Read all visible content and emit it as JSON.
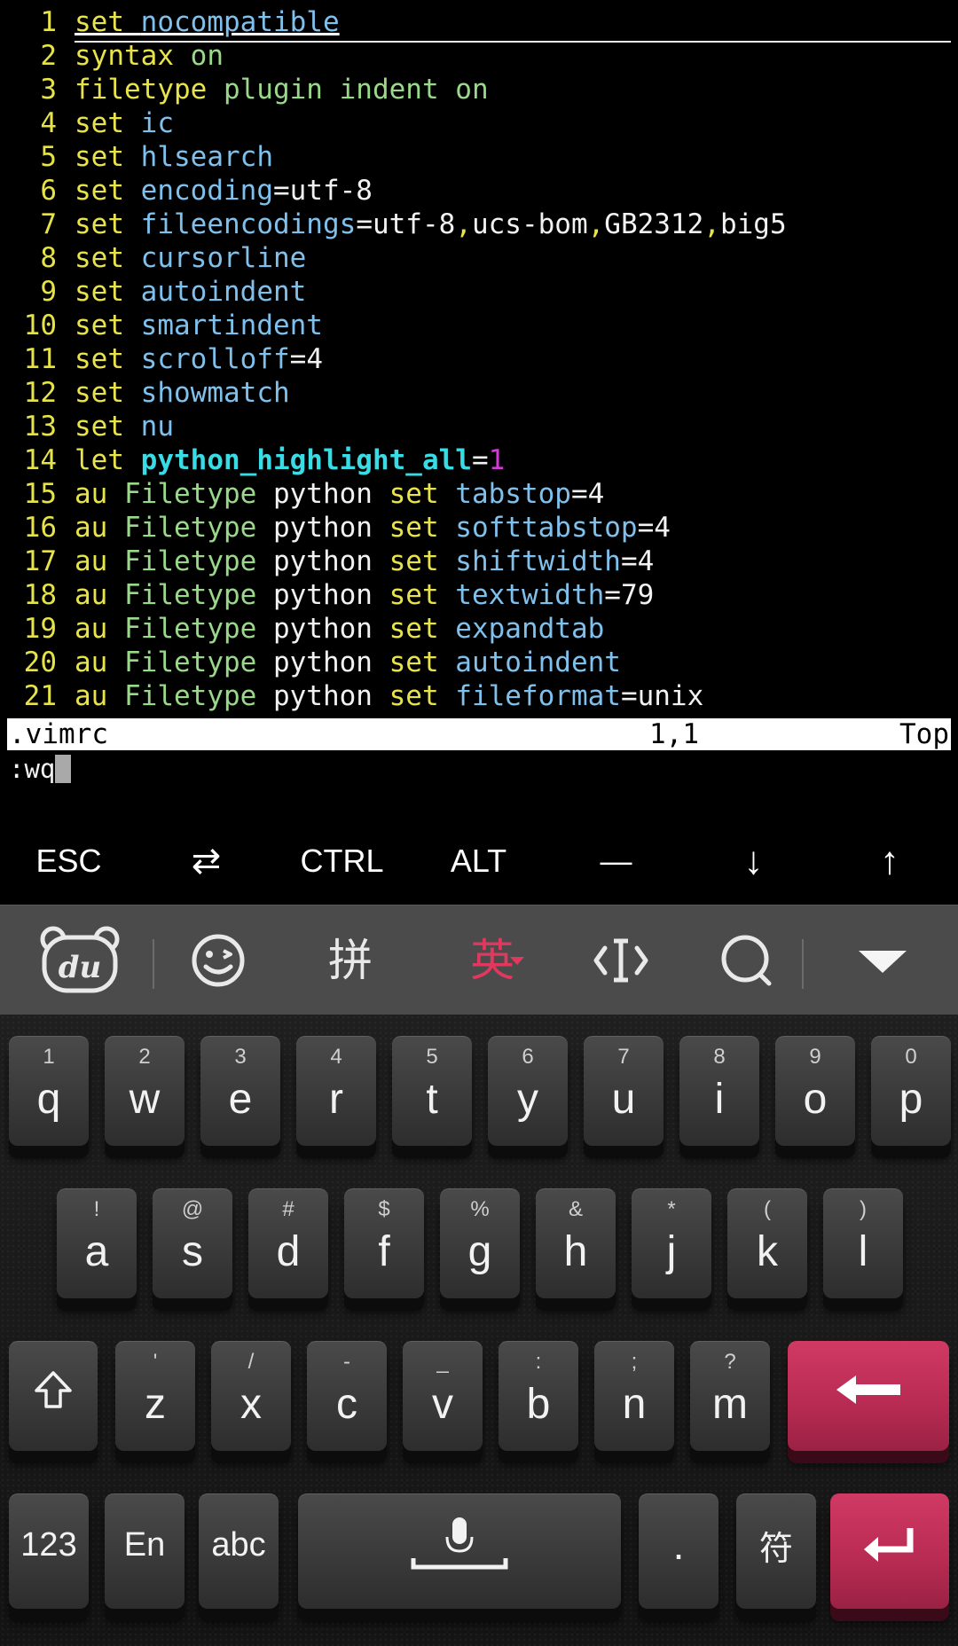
{
  "editor": {
    "lines": [
      {
        "num": "1",
        "tokens": [
          {
            "t": "set",
            "c": "kw"
          },
          {
            "t": " "
          },
          {
            "t": "nocompatible",
            "c": "opt"
          }
        ]
      },
      {
        "num": "2",
        "tokens": [
          {
            "t": "syntax",
            "c": "kw"
          },
          {
            "t": " "
          },
          {
            "t": "on",
            "c": "green"
          }
        ]
      },
      {
        "num": "3",
        "tokens": [
          {
            "t": "filetype",
            "c": "kw"
          },
          {
            "t": " "
          },
          {
            "t": "plugin",
            "c": "green"
          },
          {
            "t": " "
          },
          {
            "t": "indent",
            "c": "green"
          },
          {
            "t": " "
          },
          {
            "t": "on",
            "c": "green"
          }
        ]
      },
      {
        "num": "4",
        "tokens": [
          {
            "t": "set",
            "c": "kw"
          },
          {
            "t": " "
          },
          {
            "t": "ic",
            "c": "opt"
          }
        ]
      },
      {
        "num": "5",
        "tokens": [
          {
            "t": "set",
            "c": "kw"
          },
          {
            "t": " "
          },
          {
            "t": "hlsearch",
            "c": "opt"
          }
        ]
      },
      {
        "num": "6",
        "tokens": [
          {
            "t": "set",
            "c": "kw"
          },
          {
            "t": " "
          },
          {
            "t": "encoding",
            "c": "opt"
          },
          {
            "t": "=utf-8",
            "c": "plain"
          }
        ]
      },
      {
        "num": "7",
        "tokens": [
          {
            "t": "set",
            "c": "kw"
          },
          {
            "t": " "
          },
          {
            "t": "fileencodings",
            "c": "opt"
          },
          {
            "t": "=utf-8",
            "c": "plain"
          },
          {
            "t": ",",
            "c": "kw"
          },
          {
            "t": "ucs-bom",
            "c": "plain"
          },
          {
            "t": ",",
            "c": "kw"
          },
          {
            "t": "GB2312",
            "c": "plain"
          },
          {
            "t": ",",
            "c": "kw"
          },
          {
            "t": "big5",
            "c": "plain"
          }
        ]
      },
      {
        "num": "8",
        "tokens": [
          {
            "t": "set",
            "c": "kw"
          },
          {
            "t": " "
          },
          {
            "t": "cursorline",
            "c": "opt"
          }
        ]
      },
      {
        "num": "9",
        "tokens": [
          {
            "t": "set",
            "c": "kw"
          },
          {
            "t": " "
          },
          {
            "t": "autoindent",
            "c": "opt"
          }
        ]
      },
      {
        "num": "10",
        "tokens": [
          {
            "t": "set",
            "c": "kw"
          },
          {
            "t": " "
          },
          {
            "t": "smartindent",
            "c": "opt"
          }
        ]
      },
      {
        "num": "11",
        "tokens": [
          {
            "t": "set",
            "c": "kw"
          },
          {
            "t": " "
          },
          {
            "t": "scrolloff",
            "c": "opt"
          },
          {
            "t": "=4",
            "c": "plain"
          }
        ]
      },
      {
        "num": "12",
        "tokens": [
          {
            "t": "set",
            "c": "kw"
          },
          {
            "t": " "
          },
          {
            "t": "showmatch",
            "c": "opt"
          }
        ]
      },
      {
        "num": "13",
        "tokens": [
          {
            "t": "set",
            "c": "kw"
          },
          {
            "t": " "
          },
          {
            "t": "nu",
            "c": "opt"
          }
        ]
      },
      {
        "num": "14",
        "tokens": [
          {
            "t": "let",
            "c": "kw"
          },
          {
            "t": " "
          },
          {
            "t": "python_highlight_all",
            "c": "cyanbold"
          },
          {
            "t": "=",
            "c": "plain"
          },
          {
            "t": "1",
            "c": "magenta"
          }
        ]
      },
      {
        "num": "15",
        "tokens": [
          {
            "t": "au",
            "c": "kw"
          },
          {
            "t": " "
          },
          {
            "t": "Filetype",
            "c": "green"
          },
          {
            "t": " python ",
            "c": "plain"
          },
          {
            "t": "set",
            "c": "kw"
          },
          {
            "t": " "
          },
          {
            "t": "tabstop",
            "c": "opt"
          },
          {
            "t": "=4",
            "c": "plain"
          }
        ]
      },
      {
        "num": "16",
        "tokens": [
          {
            "t": "au",
            "c": "kw"
          },
          {
            "t": " "
          },
          {
            "t": "Filetype",
            "c": "green"
          },
          {
            "t": " python ",
            "c": "plain"
          },
          {
            "t": "set",
            "c": "kw"
          },
          {
            "t": " "
          },
          {
            "t": "softtabstop",
            "c": "opt"
          },
          {
            "t": "=4",
            "c": "plain"
          }
        ]
      },
      {
        "num": "17",
        "tokens": [
          {
            "t": "au",
            "c": "kw"
          },
          {
            "t": " "
          },
          {
            "t": "Filetype",
            "c": "green"
          },
          {
            "t": " python ",
            "c": "plain"
          },
          {
            "t": "set",
            "c": "kw"
          },
          {
            "t": " "
          },
          {
            "t": "shiftwidth",
            "c": "opt"
          },
          {
            "t": "=4",
            "c": "plain"
          }
        ]
      },
      {
        "num": "18",
        "tokens": [
          {
            "t": "au",
            "c": "kw"
          },
          {
            "t": " "
          },
          {
            "t": "Filetype",
            "c": "green"
          },
          {
            "t": " python ",
            "c": "plain"
          },
          {
            "t": "set",
            "c": "kw"
          },
          {
            "t": " "
          },
          {
            "t": "textwidth",
            "c": "opt"
          },
          {
            "t": "=79",
            "c": "plain"
          }
        ]
      },
      {
        "num": "19",
        "tokens": [
          {
            "t": "au",
            "c": "kw"
          },
          {
            "t": " "
          },
          {
            "t": "Filetype",
            "c": "green"
          },
          {
            "t": " python ",
            "c": "plain"
          },
          {
            "t": "set",
            "c": "kw"
          },
          {
            "t": " "
          },
          {
            "t": "expandtab",
            "c": "opt"
          }
        ]
      },
      {
        "num": "20",
        "tokens": [
          {
            "t": "au",
            "c": "kw"
          },
          {
            "t": " "
          },
          {
            "t": "Filetype",
            "c": "green"
          },
          {
            "t": " python ",
            "c": "plain"
          },
          {
            "t": "set",
            "c": "kw"
          },
          {
            "t": " "
          },
          {
            "t": "autoindent",
            "c": "opt"
          }
        ]
      },
      {
        "num": "21",
        "tokens": [
          {
            "t": "au",
            "c": "kw"
          },
          {
            "t": " "
          },
          {
            "t": "Filetype",
            "c": "green"
          },
          {
            "t": " python ",
            "c": "plain"
          },
          {
            "t": "set",
            "c": "kw"
          },
          {
            "t": " "
          },
          {
            "t": "fileformat",
            "c": "opt"
          },
          {
            "t": "=unix",
            "c": "plain"
          }
        ]
      }
    ],
    "statusline": {
      "filename": ".vimrc",
      "position": "1,1",
      "scroll": "Top"
    },
    "command": ":wq"
  },
  "extra_keys": {
    "esc": "ESC",
    "tab": "⇄",
    "ctrl": "CTRL",
    "alt": "ALT",
    "dash": "—",
    "down": "↓",
    "up": "↑"
  },
  "ime_toolbar": {
    "logo_text": "du",
    "pinyin": "拼",
    "english": "英",
    "icons": [
      "baidu-bear-icon",
      "emoji-icon",
      "cursor-move-icon",
      "search-icon",
      "collapse-icon"
    ]
  },
  "keyboard": {
    "row1": [
      {
        "hint": "1",
        "key": "q"
      },
      {
        "hint": "2",
        "key": "w"
      },
      {
        "hint": "3",
        "key": "e"
      },
      {
        "hint": "4",
        "key": "r"
      },
      {
        "hint": "5",
        "key": "t"
      },
      {
        "hint": "6",
        "key": "y"
      },
      {
        "hint": "7",
        "key": "u"
      },
      {
        "hint": "8",
        "key": "i"
      },
      {
        "hint": "9",
        "key": "o"
      },
      {
        "hint": "0",
        "key": "p"
      }
    ],
    "row2": [
      {
        "hint": "!",
        "key": "a"
      },
      {
        "hint": "@",
        "key": "s"
      },
      {
        "hint": "#",
        "key": "d"
      },
      {
        "hint": "$",
        "key": "f"
      },
      {
        "hint": "%",
        "key": "g"
      },
      {
        "hint": "&",
        "key": "h"
      },
      {
        "hint": "*",
        "key": "j"
      },
      {
        "hint": "(",
        "key": "k"
      },
      {
        "hint": ")",
        "key": "l"
      }
    ],
    "row3": [
      {
        "hint": "'",
        "key": "z"
      },
      {
        "hint": "/",
        "key": "x"
      },
      {
        "hint": "-",
        "key": "c"
      },
      {
        "hint": "_",
        "key": "v"
      },
      {
        "hint": ":",
        "key": "b"
      },
      {
        "hint": ";",
        "key": "n"
      },
      {
        "hint": "?",
        "key": "m"
      }
    ],
    "row4": {
      "num": "123",
      "en": "En",
      "abc": "abc",
      "period": ".",
      "symbol": "符"
    },
    "colors": {
      "accent": "#c22f5a",
      "key_bg": "#3c3c3c",
      "ime_english": "#e0385f"
    }
  }
}
